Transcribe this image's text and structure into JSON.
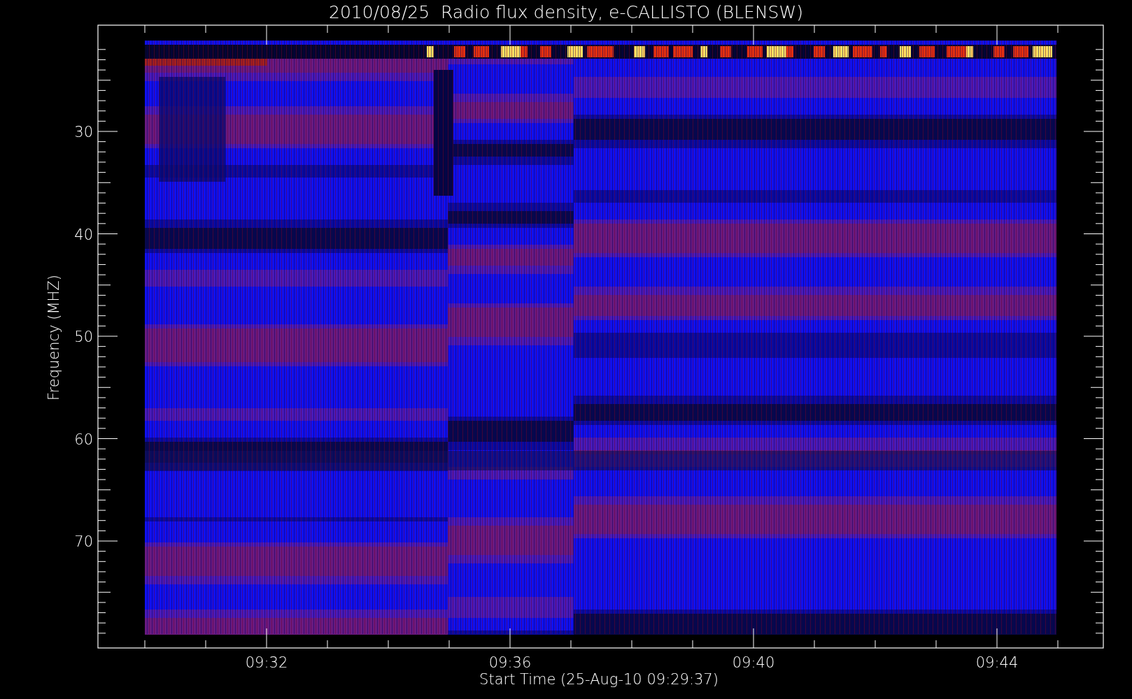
{
  "title": "2010/08/25  Radio flux density, e-CALLISTO (BLENSW)",
  "y_axis": {
    "label": "Frequency (MHZ)",
    "ticks": [
      "30",
      "40",
      "50",
      "60",
      "70"
    ]
  },
  "x_axis": {
    "label": "Start Time (25-Aug-10 09:29:37)",
    "ticks": [
      "09:32",
      "09:36",
      "09:40",
      "09:44"
    ]
  }
}
